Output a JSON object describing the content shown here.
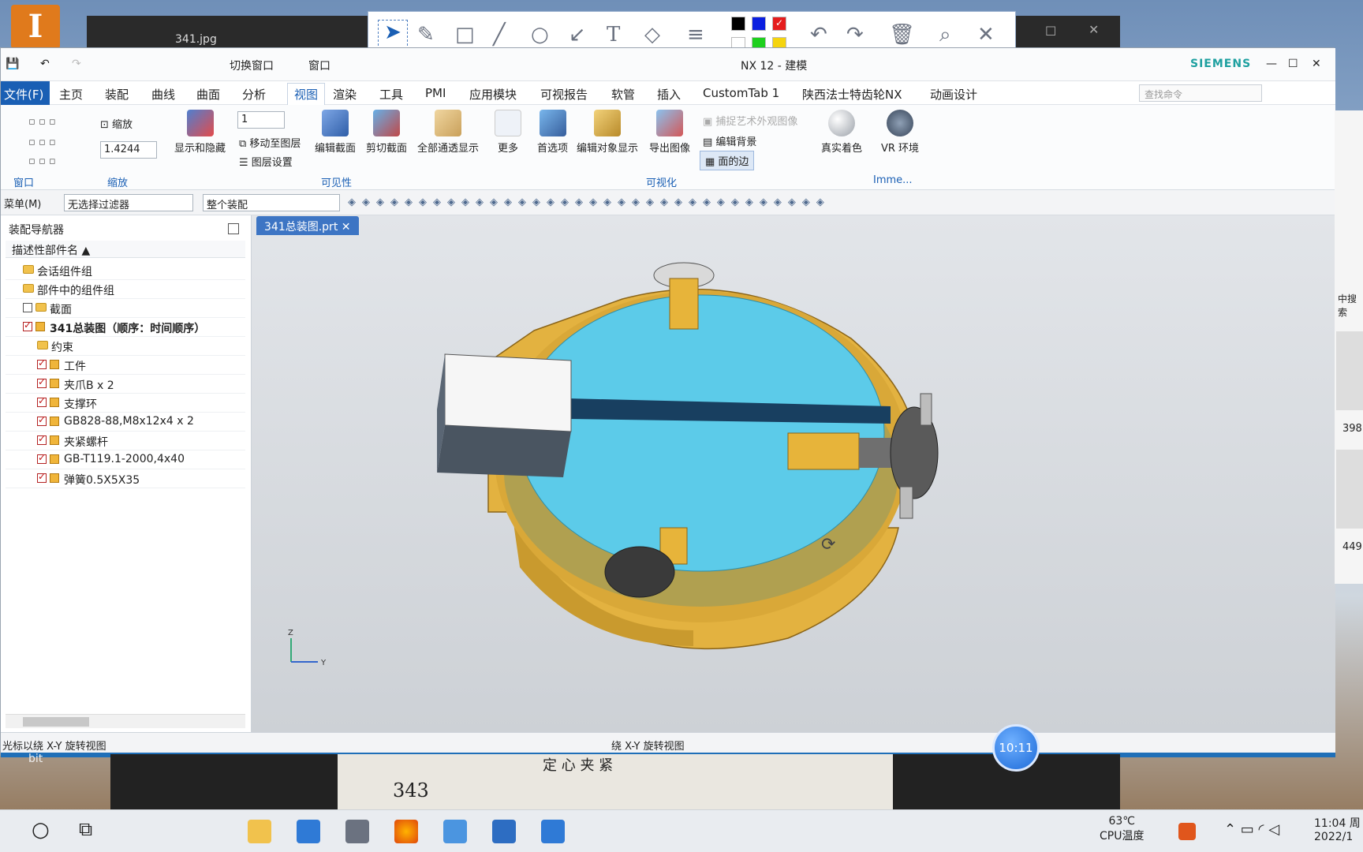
{
  "desktop": {
    "icon_letter": "I",
    "bg_window_title": "341.jpg",
    "left_label": "bit"
  },
  "window": {
    "title": "NX 12 - 建模",
    "brand": "SIEMENS",
    "qat": {
      "switch_window": "切换窗口",
      "window": "窗口"
    }
  },
  "menu": {
    "file": "文件(F)",
    "items": [
      "主页",
      "装配",
      "曲线",
      "曲面",
      "分析",
      "视图",
      "渲染",
      "工具",
      "PMI",
      "应用模块",
      "可视报告",
      "软管",
      "插入",
      "CustomTab 1",
      "陕西法士特齿轮NX",
      "动画设计"
    ],
    "active": "视图",
    "search_placeholder": "查找命令"
  },
  "ribbon": {
    "groups": {
      "window": "窗口",
      "zoom": "缩放",
      "visibility": "可见性",
      "visualization": "可视化",
      "immersive": "Imme..."
    },
    "zoom_label": "缩放",
    "zoom_value": "1.4244",
    "layer_select": "1",
    "show_hide": "显示和隐藏",
    "move_to_layer": "移动至图层",
    "layer_settings": "图层设置",
    "edit_section": "编辑截面",
    "clip_section": "剪切截面",
    "all_transparent": "全部通透显示",
    "more": "更多",
    "preferences": "首选项",
    "edit_object_display": "编辑对象显示",
    "export_image": "导出图像",
    "capture_art": "捕捉艺术外观图像",
    "edit_background": "编辑背景",
    "face_edges": "面的边",
    "true_shading": "真实着色",
    "vr_env": "VR 环境"
  },
  "toolbar2": {
    "menu": "菜单(M)",
    "filter": "无选择过滤器",
    "scope": "整个装配"
  },
  "navigator": {
    "title": "装配导航器",
    "column": "描述性部件名",
    "rows": [
      {
        "label": "会话组件组"
      },
      {
        "label": "部件中的组件组"
      },
      {
        "label": "截面"
      },
      {
        "label": "341总装图（顺序：时间顺序）"
      },
      {
        "label": "约束"
      },
      {
        "label": "工件"
      },
      {
        "label": "夹爪B x 2"
      },
      {
        "label": "支撑环"
      },
      {
        "label": "GB828-88,M8x12x4 x 2"
      },
      {
        "label": "夹紧螺杆"
      },
      {
        "label": "GB-T119.1-2000,4x40"
      },
      {
        "label": "弹簧0.5X5X35"
      }
    ]
  },
  "viewport": {
    "tab": "341总装图.prt",
    "triad_z": "Z",
    "triad_y": "Y"
  },
  "status": {
    "left": "光标以绕 X-Y 旋转视图",
    "center": "绕 X-Y 旋转视图"
  },
  "bubble_time": "10:11",
  "right_strip": {
    "search": "中搜索",
    "num1": "398",
    "num2": "449"
  },
  "scan": {
    "number": "343",
    "text": "定 心 夹 紧"
  },
  "taskbar": {
    "temp": "63℃",
    "temp_label": "CPU温度",
    "time": "11:04 周",
    "date": "2022/1"
  },
  "colors": {
    "accent": "#1a5fb4",
    "teal": "#5fcde9",
    "gold": "#e8b43c"
  }
}
